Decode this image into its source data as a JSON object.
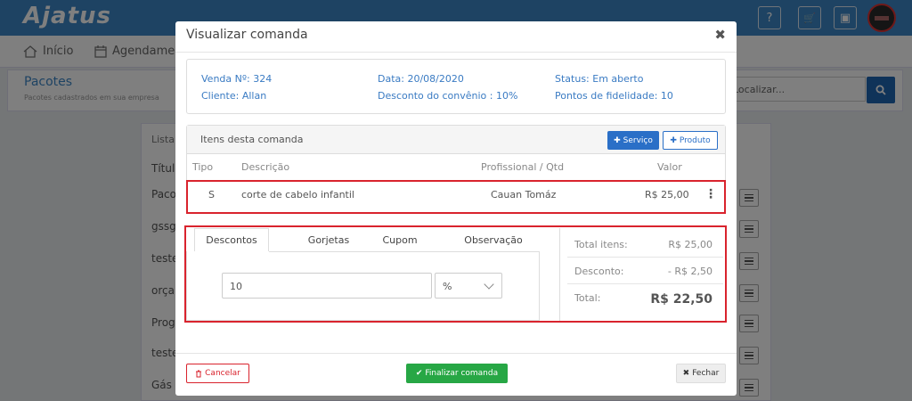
{
  "app": {
    "logo": "Ajatus"
  },
  "nav": {
    "help": "?",
    "cart": "🛒",
    "calendar": "▣"
  },
  "menu": {
    "inicio": "Início",
    "agendamentos": "Agendame"
  },
  "page": {
    "title": "Pacotes",
    "subtitle": "Pacotes cadastrados em sua empresa"
  },
  "search": {
    "value": "Localizar..."
  },
  "list": {
    "header": "Lista",
    "col_title": "Título",
    "rows": [
      "Paco",
      "gssg",
      "teste",
      "orça",
      "Prog",
      "teste",
      "Gás"
    ]
  },
  "modal": {
    "title": "Visualizar comanda",
    "close": "✖",
    "info": {
      "venda": "Venda Nº: 324",
      "cliente": "Cliente: Allan",
      "data": "Data: 20/08/2020",
      "desconto_convenio": "Desconto do convênio : 10%",
      "status": "Status: Em aberto",
      "pontos": "Pontos de fidelidade: 10"
    },
    "items": {
      "header": "Itens desta comanda",
      "btn_servico": "Serviço",
      "btn_produto": "Produto",
      "columns": {
        "tipo": "Tipo",
        "descricao": "Descrição",
        "profissional": "Profissional / Qtd",
        "valor": "Valor"
      },
      "rows": [
        {
          "tipo": "S",
          "descricao": "corte de cabelo infantil",
          "profissional": "Cauan Tomáz",
          "valor": "R$ 25,00",
          "menu": "⋮"
        }
      ]
    },
    "tabs": [
      "Descontos",
      "Gorjetas",
      "Cupom",
      "Observação"
    ],
    "discount": {
      "value": "10",
      "unit": "%"
    },
    "totals": {
      "items_label": "Total itens:",
      "items_value": "R$ 25,00",
      "desconto_label": "Desconto:",
      "desconto_value": "- R$ 2,50",
      "total_label": "Total:",
      "total_value": "R$ 22,50"
    },
    "footer": {
      "cancelar": "Cancelar",
      "finalizar": "Finalizar comanda",
      "fechar": "Fechar"
    }
  },
  "colors": {
    "primary": "#3d86c6",
    "highlight": "#d9232d",
    "success": "#27a745"
  }
}
